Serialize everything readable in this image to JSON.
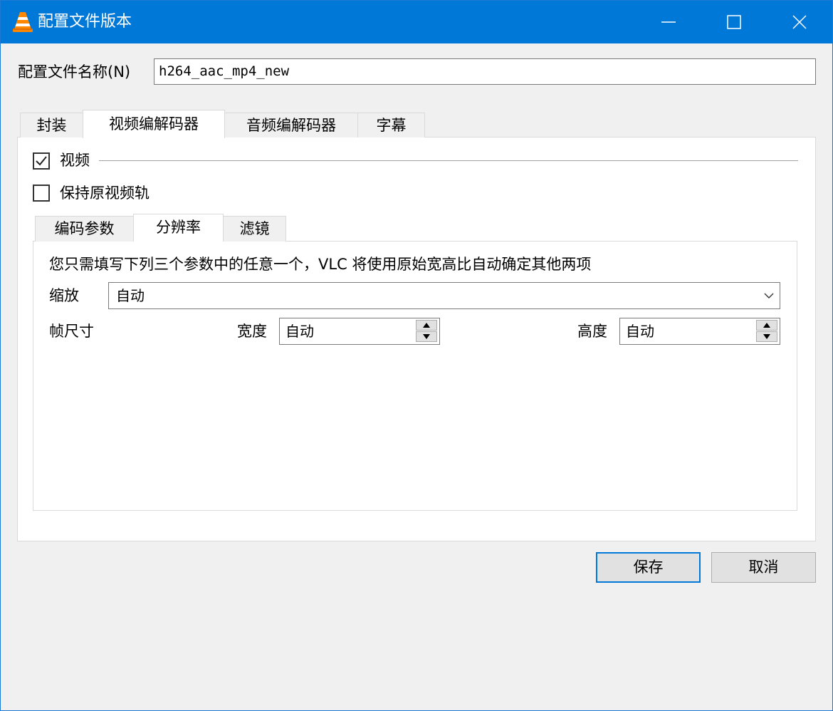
{
  "window": {
    "title": "配置文件版本",
    "accent": "#0078d7"
  },
  "profile": {
    "label": "配置文件名称(N)",
    "value": "h264_aac_mp4_new"
  },
  "tabs": [
    {
      "label": "封装",
      "active": false
    },
    {
      "label": "视频编解码器",
      "active": true
    },
    {
      "label": "音频编解码器",
      "active": false
    },
    {
      "label": "字幕",
      "active": false
    }
  ],
  "video": {
    "video_label": "视频",
    "video_checked": true,
    "keep_label": "保持原视频轨",
    "keep_checked": false
  },
  "subtabs": [
    {
      "label": "编码参数",
      "active": false
    },
    {
      "label": "分辨率",
      "active": true
    },
    {
      "label": "滤镜",
      "active": false
    }
  ],
  "resolution": {
    "info": "您只需填写下列三个参数中的任意一个，VLC 将使用原始宽高比自动确定其他两项",
    "scale_label": "缩放",
    "scale_value": "自动",
    "frame_size_label": "帧尺寸",
    "width_label": "宽度",
    "width_value": "自动",
    "height_label": "高度",
    "height_value": "自动"
  },
  "buttons": {
    "save": "保存",
    "cancel": "取消"
  },
  "icons": {
    "app": "vlc-cone-icon",
    "minimize": "minimize-icon",
    "maximize": "maximize-icon",
    "close": "close-icon",
    "check": "checkmark-icon",
    "dropdown": "chevron-down-icon",
    "spin_up": "triangle-up-icon",
    "spin_down": "triangle-down-icon"
  }
}
